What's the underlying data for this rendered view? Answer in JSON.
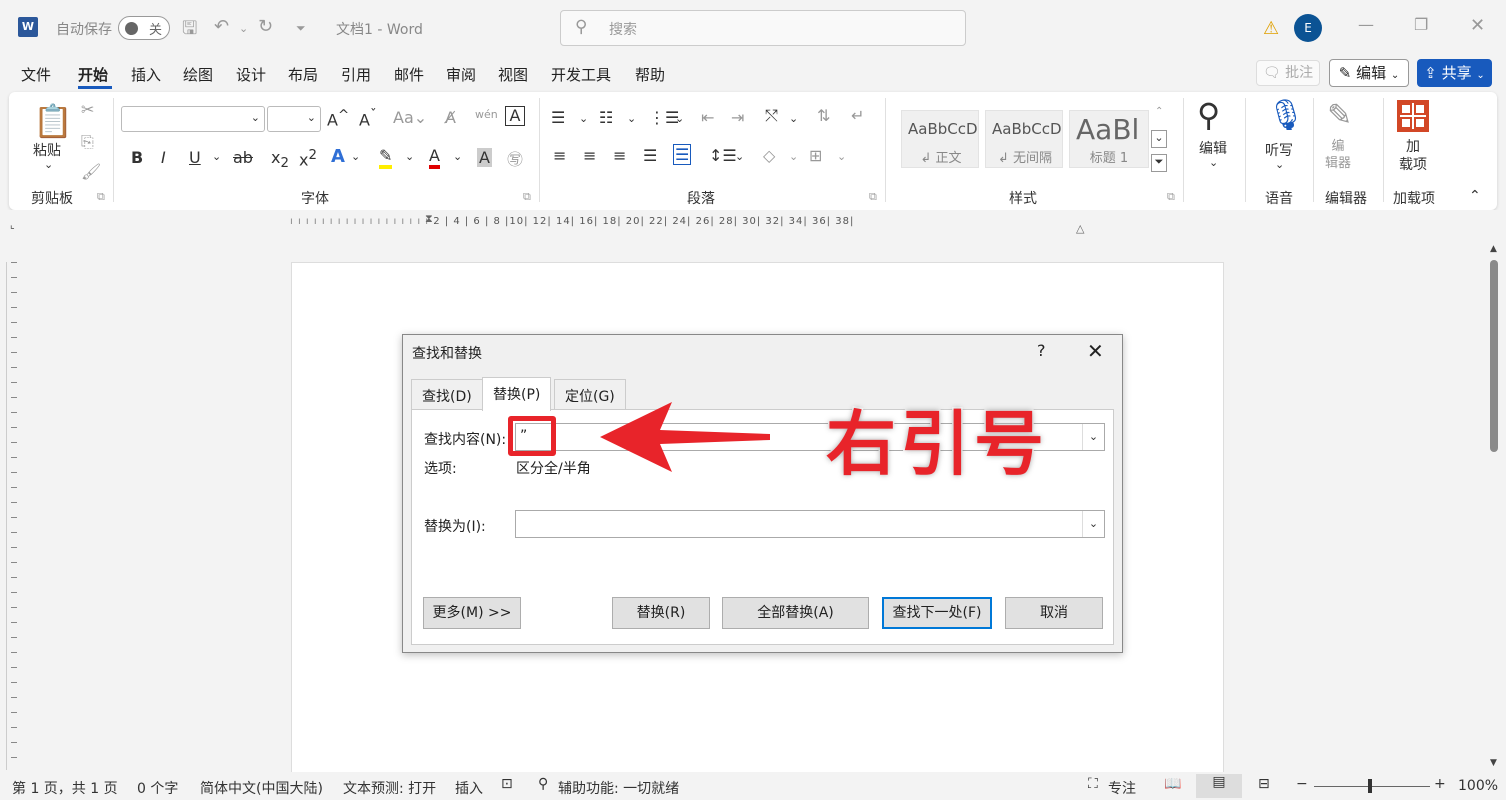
{
  "titlebar": {
    "autosave_label": "自动保存",
    "autosave_state": "关",
    "doc_title": "文档1  -  Word",
    "search_placeholder": "搜索",
    "avatar_initial": "E"
  },
  "menubar": {
    "items": [
      "文件",
      "开始",
      "插入",
      "绘图",
      "设计",
      "布局",
      "引用",
      "邮件",
      "审阅",
      "视图",
      "开发工具",
      "帮助"
    ],
    "active": "开始",
    "comment": "批注",
    "edit": "编辑",
    "share": "共享"
  },
  "ribbon": {
    "paste": "粘贴",
    "groups": {
      "clipboard": "剪贴板",
      "font": "字体",
      "paragraph": "段落",
      "styles": "样式",
      "voice": "语音",
      "editor": "编辑器",
      "addins": "加载项"
    },
    "styles": [
      {
        "preview": "AaBbCcDc",
        "name": "↲ 正文"
      },
      {
        "preview": "AaBbCcDc",
        "name": "↲ 无间隔"
      },
      {
        "preview": "AaBl",
        "name": "标题 1"
      }
    ],
    "edit": "编辑",
    "dictate": "听写",
    "editor_btn": "编\n辑器",
    "addin_btn": "加\n载项"
  },
  "ruler": "2  |  4  |  6  |  8  |10|  12|  14|  16|  18|  20|  22|  24|  26|  28|  30|  32|  34|  36|  38|",
  "dialog": {
    "title": "查找和替换",
    "help": "?",
    "tabs": [
      "查找(D)",
      "替换(P)",
      "定位(G)"
    ],
    "selected_tab": "替换(P)",
    "find_label": "查找内容(N):",
    "find_value": "”",
    "options_label": "选项:",
    "options_value": "区分全/半角",
    "replace_label": "替换为(I):",
    "replace_value": "",
    "buttons": {
      "more": "更多(M) >>",
      "replace": "替换(R)",
      "replace_all": "全部替换(A)",
      "find_next": "查找下一处(F)",
      "cancel": "取消"
    }
  },
  "annotation": {
    "text": "右引号",
    "color": "#e8242a"
  },
  "statusbar": {
    "page": "第 1 页，共 1 页",
    "words": "0 个字",
    "language": "简体中文(中国大陆)",
    "prediction": "文本预测: 打开",
    "insert": "插入",
    "accessibility": "辅助功能: 一切就绪",
    "focus": "专注",
    "zoom": "100%"
  }
}
